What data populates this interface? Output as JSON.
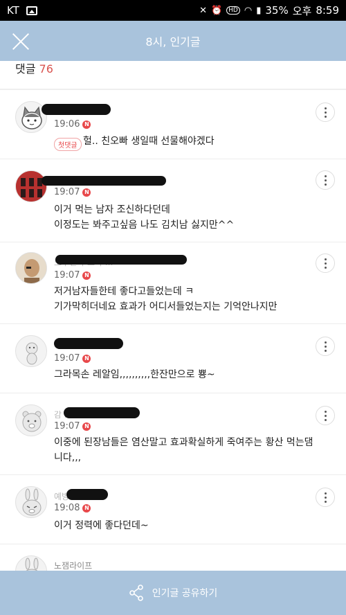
{
  "status_bar": {
    "carrier": "KT",
    "battery": "35%",
    "time_prefix": "오후",
    "time": "8:59",
    "hd": "HD"
  },
  "header": {
    "title": "8시, 인기글"
  },
  "comments_section": {
    "label": "댓글",
    "count": "76"
  },
  "badges": {
    "new": "N",
    "first_comment": "첫댓글"
  },
  "comments": [
    {
      "time": "19:06",
      "text": "헐.. 친오빠 생일때 선물해야겠다"
    },
    {
      "time": "19:07",
      "text": "이거 먹는 남자 조신하다던데\n이정도는 봐주고싶음 나도 김치남 싫지만^^"
    },
    {
      "time": "19:07",
      "text": "저거남자들한테 좋다고들었는데 ㅋ\n기가막히더네요 효과가 어디서들었는지는 기억안나지만"
    },
    {
      "time": "19:07",
      "text": "그라목손 레알임,,,,,,,,,,한잔만으로 뿅~"
    },
    {
      "time": "19:07",
      "text": "이중에 된장남들은 염산말고 효과확실하게 죽여주는 황산 먹는댐\n니다,,,"
    },
    {
      "time": "19:08",
      "text": "이거 정력에 좋다던데~"
    },
    {
      "username": "노잼라이프"
    }
  ],
  "partial_usernames": {
    "c3": "노구인가 노가 ...",
    "c5": "감 ...",
    "c6": "예방 ..."
  },
  "share": {
    "label": "인기글 공유하기",
    "icon": "share-icon"
  },
  "colors": {
    "header_bg": "#a9c3dc",
    "accent_red": "#e8474a",
    "count_red": "#d9534f"
  }
}
